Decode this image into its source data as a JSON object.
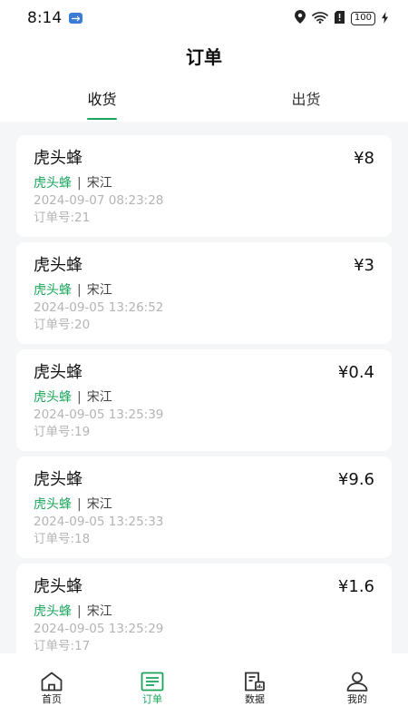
{
  "status": {
    "time": "8:14",
    "battery": "100"
  },
  "header": {
    "title": "订单"
  },
  "tabs": [
    {
      "label": "收货",
      "active": true
    },
    {
      "label": "出货",
      "active": false
    }
  ],
  "orders": [
    {
      "title": "虎头蜂",
      "price": "¥8",
      "merchant": "虎头蜂",
      "separator": "|",
      "person": "宋江",
      "time": "2024-09-07 08:23:28",
      "order_no": "订单号:21"
    },
    {
      "title": "虎头蜂",
      "price": "¥3",
      "merchant": "虎头蜂",
      "separator": "|",
      "person": "宋江",
      "time": "2024-09-05 13:26:52",
      "order_no": "订单号:20"
    },
    {
      "title": "虎头蜂",
      "price": "¥0.4",
      "merchant": "虎头蜂",
      "separator": "|",
      "person": "宋江",
      "time": "2024-09-05 13:25:39",
      "order_no": "订单号:19"
    },
    {
      "title": "虎头蜂",
      "price": "¥9.6",
      "merchant": "虎头蜂",
      "separator": "|",
      "person": "宋江",
      "time": "2024-09-05 13:25:33",
      "order_no": "订单号:18"
    },
    {
      "title": "虎头蜂",
      "price": "¥1.6",
      "merchant": "虎头蜂",
      "separator": "|",
      "person": "宋江",
      "time": "2024-09-05 13:25:29",
      "order_no": "订单号:17"
    }
  ],
  "nav": {
    "home": "首页",
    "orders": "订单",
    "data": "数据",
    "mine": "我的"
  },
  "colors": {
    "accent": "#19a55a",
    "muted": "#b4b4b4",
    "background": "#f5f6f8"
  }
}
